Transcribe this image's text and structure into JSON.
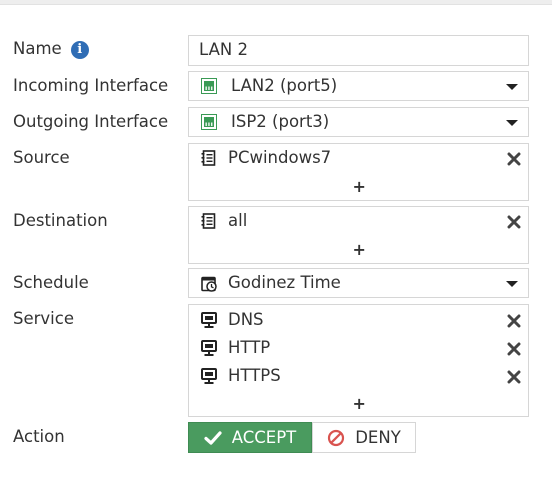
{
  "labels": {
    "name": "Name",
    "incoming": "Incoming Interface",
    "outgoing": "Outgoing Interface",
    "source": "Source",
    "destination": "Destination",
    "schedule": "Schedule",
    "service": "Service",
    "action": "Action"
  },
  "name_value": "LAN 2",
  "incoming_interface": {
    "value": "LAN2 (port5)",
    "icon": "network-port-icon"
  },
  "outgoing_interface": {
    "value": "ISP2 (port3)",
    "icon": "network-port-icon"
  },
  "source": {
    "entries": [
      "PCwindows7"
    ],
    "add_label": "+"
  },
  "destination": {
    "entries": [
      "all"
    ],
    "add_label": "+"
  },
  "schedule": {
    "value": "Godinez Time",
    "icon": "schedule-icon"
  },
  "service": {
    "entries": [
      "DNS",
      "HTTP",
      "HTTPS"
    ],
    "add_label": "+"
  },
  "action": {
    "accept_label": "ACCEPT",
    "deny_label": "DENY",
    "selected": "ACCEPT"
  },
  "colors": {
    "accept_bg": "#4a9b5f",
    "deny_icon": "#d9534f",
    "info_icon": "#2f6db5",
    "port_icon": "#3a9a55"
  }
}
